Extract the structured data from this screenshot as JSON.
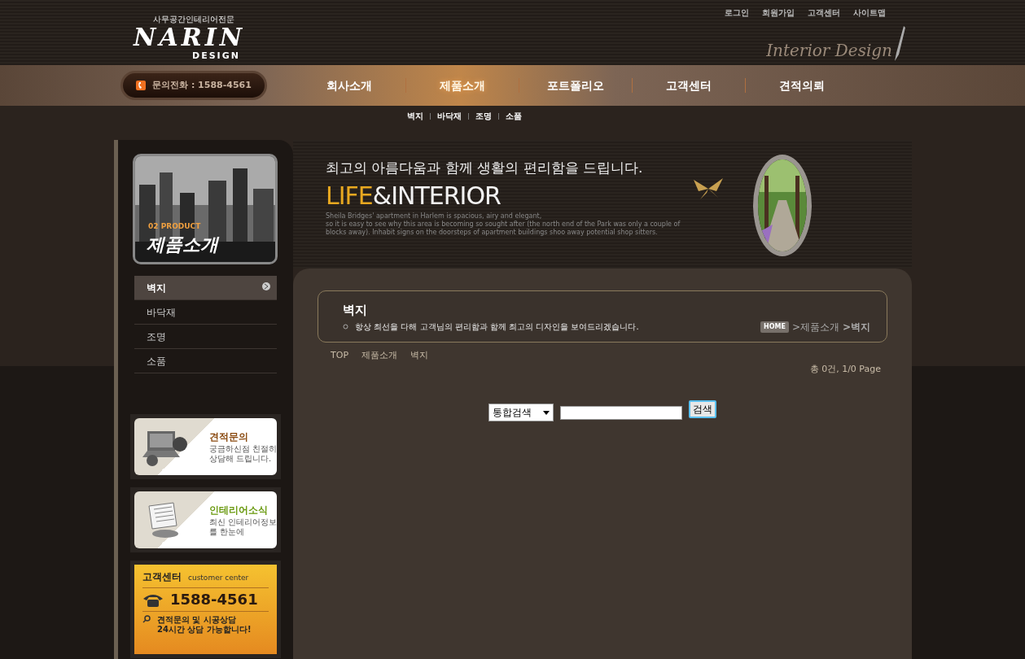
{
  "logo": {
    "tagline": "사무공간인테리어전문",
    "name": "NARIN",
    "sub": "DESIGN"
  },
  "top_links": [
    "로그인",
    "회원가입",
    "고객센터",
    "사이트맵"
  ],
  "header_script": "Interior Design",
  "phone_pill": "문의전화 : 1588-4561",
  "nav": [
    {
      "label": "회사소개",
      "selected": false
    },
    {
      "label": "제품소개",
      "selected": true
    },
    {
      "label": "포트폴리오",
      "selected": false
    },
    {
      "label": "고객센터",
      "selected": false
    },
    {
      "label": "견적의뢰",
      "selected": false
    }
  ],
  "subnav": [
    "벽지",
    "바닥재",
    "조명",
    "소품"
  ],
  "sidebar": {
    "eyebrow": "02 PRODUCT",
    "title": "제품소개",
    "menu": [
      {
        "label": "벽지",
        "selected": true
      },
      {
        "label": "바닥재",
        "selected": false
      },
      {
        "label": "조명",
        "selected": false
      },
      {
        "label": "소품",
        "selected": false
      }
    ]
  },
  "side_banners": [
    {
      "kind": "estimate",
      "title": "견적문의",
      "lines": [
        "궁금하신점 친절히",
        "상담해 드립니다."
      ]
    },
    {
      "kind": "news",
      "title": "인테리어소식",
      "lines": [
        "최신 인테리어정보",
        "를 한눈에"
      ]
    }
  ],
  "customer_center": {
    "title": "고객센터",
    "subtitle": "customer center",
    "phone": "1588-4561",
    "note": [
      "견적문의 및 시공상담",
      "24시간 상담 가능합니다!"
    ]
  },
  "hero": {
    "headline": "최고의 아름다움과 함께 생활의 편리함을 드립니다.",
    "brand_accent": "LIFE",
    "brand_rest": "&INTERIOR",
    "fine_print": [
      "Sheila Bridges' apartment in Harlem is spacious, airy and elegant,",
      "so it is easy to see why this area is becoming so sought after (the north end of the Park was only a couple of",
      "blocks away). Inhabit signs on the doorsteps of apartment buildings shoo away potential shop sitters."
    ]
  },
  "page_header": {
    "title": "벽지",
    "description": "항상 최선을 다해 고객님의 편리함과 함께 최고의 디자인을 보여드리겠습니다.",
    "home": "HOME",
    "crumbs": [
      ">제품소개",
      ">벽지"
    ]
  },
  "breadcrumb": [
    "TOP",
    "제품소개",
    "벽지"
  ],
  "count": "총 0건, 1/0 Page",
  "search": {
    "scope": "통합검색",
    "button": "검색"
  }
}
